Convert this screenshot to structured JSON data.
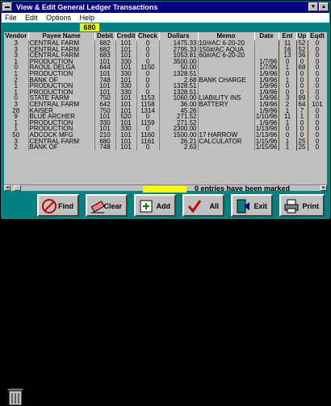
{
  "window": {
    "title": "View & Edit General Ledger Transactions"
  },
  "menu": {
    "items": [
      "File",
      "Edit",
      "Options",
      "Help"
    ]
  },
  "counter": {
    "value": "680"
  },
  "grid": {
    "columns": [
      "Vendor",
      "Payee Name",
      "Debit",
      "Credit",
      "Check",
      "Dollars",
      "Memo",
      "Date",
      "Ent",
      "Up",
      "Eqdt"
    ],
    "rows": [
      [
        "3",
        "CENTRAL FARM",
        "682",
        "101",
        "0",
        "1475.33",
        "10/#AC 6-20-20",
        "",
        "11",
        "52",
        "0"
      ],
      [
        "3",
        "CENTRAL FARM",
        "682",
        "101",
        "0",
        "2795.33",
        "150#/AC AQUA",
        "",
        "16",
        "52",
        "0"
      ],
      [
        "3",
        "CENTRAL FARM",
        "683",
        "101",
        "0",
        "1053.81",
        "60#/AC 6-20-20",
        "",
        "13",
        "36",
        "0"
      ],
      [
        "1",
        "PRODUCTION",
        "101",
        "330",
        "0",
        "3500.00",
        "",
        "1/7/96",
        "0",
        "0",
        "0"
      ],
      [
        "0",
        "RAOUL DELGA",
        "644",
        "101",
        "1150",
        "50.00",
        "",
        "1/7/96",
        "1",
        "68",
        "0"
      ],
      [
        "1",
        "PRODUCTION",
        "101",
        "330",
        "0",
        "1328.51",
        "",
        "1/9/96",
        "0",
        "0",
        "0"
      ],
      [
        "2",
        "BANK OF",
        "748",
        "101",
        "0",
        "2.68",
        "BANK CHARGE",
        "1/9/96",
        "1",
        "0",
        "0"
      ],
      [
        "1",
        "PRODUCTION",
        "101",
        "330",
        "0",
        "1328.51",
        "",
        "1/9/96",
        "0",
        "0",
        "0"
      ],
      [
        "1",
        "PRODUCTION",
        "101",
        "330",
        "0",
        "1328.51",
        "",
        "1/9/96",
        "0",
        "0",
        "0"
      ],
      [
        "0",
        "STATE FARM",
        "750",
        "101",
        "1153",
        "1060.00",
        "LIABILITY INS",
        "1/9/96",
        "3",
        "99",
        "0"
      ],
      [
        "3",
        "CENTRAL FARM",
        "642",
        "101",
        "1158",
        "36.00",
        "BATTERY",
        "1/9/96",
        "2",
        "64",
        "101"
      ],
      [
        "28",
        "KAISER",
        "750",
        "101",
        "1314",
        "45.26",
        "",
        "1/9/96",
        "1",
        "7",
        "0"
      ],
      [
        "9",
        "BLUE ARCHER",
        "101",
        "520",
        "0",
        "271.52",
        "",
        "1/10/96",
        "11",
        "1",
        "0"
      ],
      [
        "1",
        "PRODUCTION",
        "330",
        "101",
        "1159",
        "271.52",
        "",
        "1/9/96",
        "1",
        "0",
        "0"
      ],
      [
        "1",
        "PRODUCTION",
        "101",
        "330",
        "0",
        "2300.00",
        "",
        "1/13/96",
        "0",
        "0",
        "0"
      ],
      [
        "50",
        "ADCOCK MFG",
        "210",
        "101",
        "1160",
        "1500.00",
        "17 HARROW",
        "1/13/96",
        "0",
        "0",
        "0"
      ],
      [
        "3",
        "CENTRAL FARM",
        "680",
        "101",
        "1161",
        "26.21",
        "CALCULATOR",
        "1/15/96",
        "1",
        "25",
        "0"
      ],
      [
        "2",
        "BANK OF",
        "748",
        "101",
        "0",
        "2.63",
        "",
        "1/15/96",
        "1",
        "25",
        "0"
      ]
    ]
  },
  "status": {
    "marked_text": "0 entries have been marked"
  },
  "toolbar": {
    "find": "Find",
    "clear": "Clear",
    "add": "Add",
    "all": "All",
    "exit": "Exit",
    "print": "Print"
  },
  "colors": {
    "accent_teal": "#008080",
    "title_navy": "#000080",
    "highlight_yellow": "#ffff00",
    "selected_row": "#808080"
  }
}
